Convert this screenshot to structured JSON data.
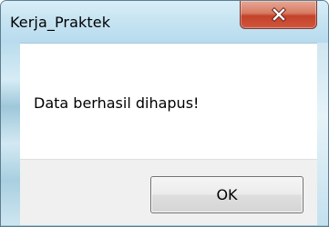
{
  "window": {
    "title": "Kerja_Praktek"
  },
  "dialog": {
    "message": "Data berhasil dihapus!",
    "ok_label": "OK"
  },
  "icons": {
    "close": "close-icon"
  },
  "colors": {
    "close_button": "#c4412a",
    "frame": "#bfe0f0",
    "client_background": "#ffffff",
    "button_area": "#f0f0f0"
  }
}
